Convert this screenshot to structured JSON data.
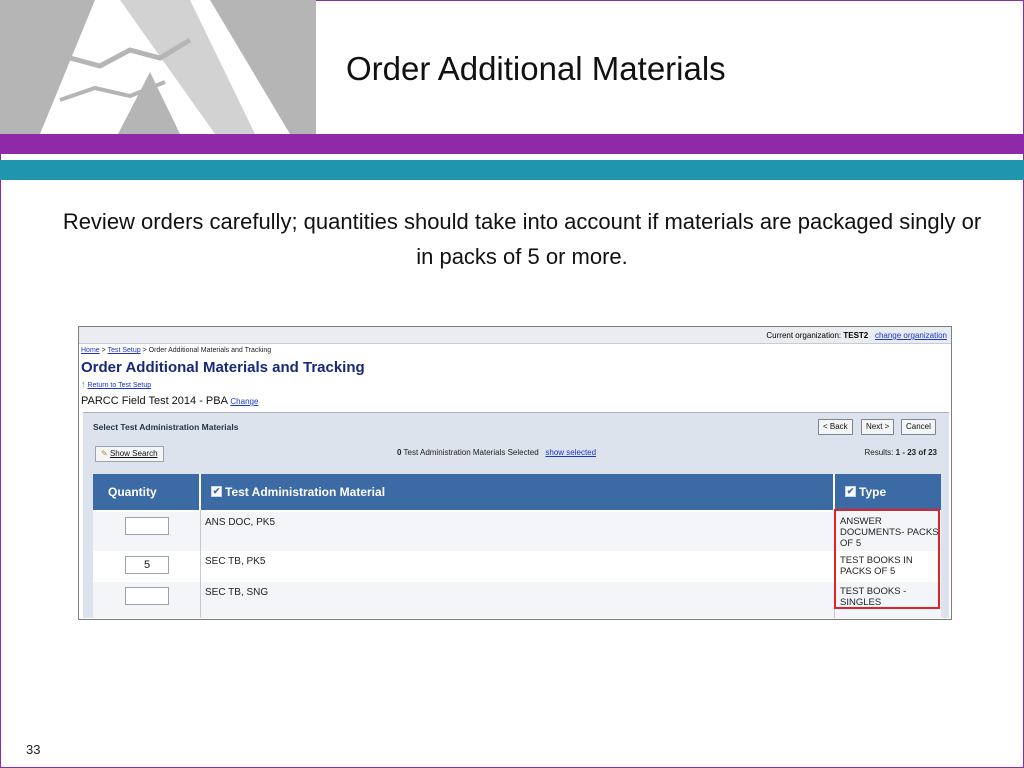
{
  "slide": {
    "title": "Order Additional Materials",
    "intro": "Review orders carefully; quantities should take into account if materials are packaged singly or in packs of 5 or more.",
    "page_number": "33",
    "colors": {
      "purple_band": "#8e2aa8",
      "teal_band": "#1f96ad",
      "logo_bg": "#b5b5b5"
    }
  },
  "app": {
    "org_bar": {
      "label": "Current organization:",
      "org": "TEST2",
      "change_link": "change organization"
    },
    "breadcrumb": {
      "home": "Home",
      "sep1": ">",
      "test_setup": "Test Setup",
      "sep2": ">",
      "current": "Order Additional Materials and Tracking"
    },
    "page_title": "Order Additional Materials and Tracking",
    "return_link": "Return to Test Setup",
    "test_name": "PARCC Field Test 2014 - PBA",
    "test_change_link": "Change",
    "panel": {
      "title": "Select Test Administration Materials",
      "buttons": {
        "back": "< Back",
        "next": "Next >",
        "cancel": "Cancel"
      },
      "show_search": "Show Search",
      "selected_count": "0",
      "selected_text": "Test Administration Materials Selected",
      "show_selected": "show selected",
      "results_label": "Results:",
      "results_value": "1 - 23 of 23"
    },
    "table": {
      "headers": {
        "quantity": "Quantity",
        "material": "Test Administration Material",
        "type": "Type"
      },
      "rows": [
        {
          "quantity": "",
          "material": "ANS DOC,  PK5",
          "type": "ANSWER DOCUMENTS- PACKS OF 5"
        },
        {
          "quantity": "5",
          "material": "SEC TB,  PK5",
          "type": "TEST BOOKS IN PACKS OF 5"
        },
        {
          "quantity": "",
          "material": "SEC TB, SNG",
          "type": "TEST BOOKS - SINGLES"
        }
      ]
    }
  }
}
